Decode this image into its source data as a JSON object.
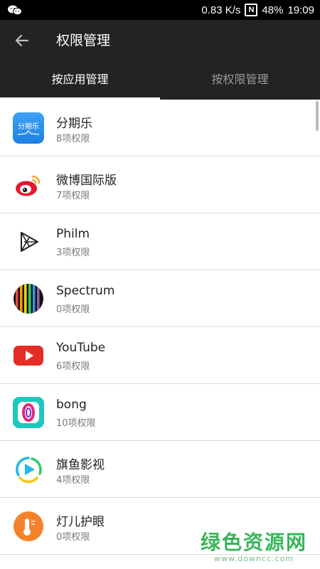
{
  "status_bar": {
    "speed": "0.83 K/s",
    "nfc": "N",
    "battery": "48%",
    "time": "19:09"
  },
  "header": {
    "title": "权限管理"
  },
  "tabs": [
    {
      "label": "按应用管理",
      "active": true
    },
    {
      "label": "按权限管理",
      "active": false
    }
  ],
  "apps": [
    {
      "name": "分期乐",
      "count": "8项权限",
      "icon": "fenqile-icon",
      "icon_text": "分期乐"
    },
    {
      "name": "微博国际版",
      "count": "7项权限",
      "icon": "weibo-icon"
    },
    {
      "name": "Philm",
      "count": "3项权限",
      "icon": "philm-icon"
    },
    {
      "name": "Spectrum",
      "count": "0项权限",
      "icon": "spectrum-icon"
    },
    {
      "name": "YouTube",
      "count": "6项权限",
      "icon": "youtube-icon"
    },
    {
      "name": "bong",
      "count": "10项权限",
      "icon": "bong-icon"
    },
    {
      "name": "旗鱼影视",
      "count": "4项权限",
      "icon": "qiyu-icon"
    },
    {
      "name": "灯儿护眼",
      "count": "0项权限",
      "icon": "denger-icon"
    }
  ],
  "watermark": {
    "title": "绿色资源网",
    "url": "www.downcc.com"
  },
  "colors": {
    "app_bar": "#232323",
    "watermark_green": "#38b65a"
  }
}
